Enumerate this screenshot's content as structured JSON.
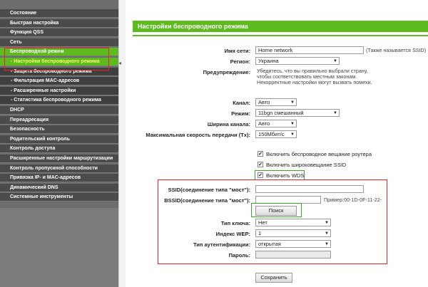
{
  "sidebar": {
    "items": [
      {
        "label": "Состояние",
        "type": "main"
      },
      {
        "label": "Быстрая настройка",
        "type": "main"
      },
      {
        "label": "Функция QSS",
        "type": "main"
      },
      {
        "label": "Сеть",
        "type": "main"
      },
      {
        "label": "Беспроводной режим",
        "type": "active"
      },
      {
        "label": "- Настройки беспроводного режима",
        "type": "sub-active"
      },
      {
        "label": "- Защита беспроводного режима",
        "type": "sub"
      },
      {
        "label": "- Фильтрация MAC-адресов",
        "type": "sub"
      },
      {
        "label": "- Расширенные настройки",
        "type": "sub"
      },
      {
        "label": "- Статистика беспроводного режима",
        "type": "sub"
      },
      {
        "label": "DHCP",
        "type": "main"
      },
      {
        "label": "Переадресация",
        "type": "main"
      },
      {
        "label": "Безопасность",
        "type": "main"
      },
      {
        "label": "Родительский контроль",
        "type": "main"
      },
      {
        "label": "Контроль доступа",
        "type": "main"
      },
      {
        "label": "Расширенные настройки маршрутизации",
        "type": "main"
      },
      {
        "label": "Контроль пропускной способности",
        "type": "main"
      },
      {
        "label": "Привязка IP- и MAC-адресов",
        "type": "main"
      },
      {
        "label": "Динамический DNS",
        "type": "main"
      },
      {
        "label": "Системные инструменты",
        "type": "main"
      }
    ]
  },
  "page": {
    "title": "Настройки беспроводного режима"
  },
  "form": {
    "ssid_label": "Имя сети:",
    "ssid_value": "Home network",
    "ssid_note": "(Также называется SSID)",
    "region_label": "Регион:",
    "region_value": "Украина",
    "warning_label": "Предупреждение:",
    "warning_lines": [
      "Убедитесь, что вы правильно выбрали страну,",
      "чтобы соответствовать местным законам.",
      "Некорректные настройки могут вызвать помехи."
    ],
    "channel_label": "Канал:",
    "channel_value": "Авто",
    "mode_label": "Режим:",
    "mode_value": "11bgn смешанный",
    "width_label": "Ширина канала:",
    "width_value": "Авто",
    "rate_label": "Максимальная скорость передачи (Tx):",
    "rate_value": "150Мбит/с",
    "check_broadcast": "Включить беспроводное вещание роутера",
    "check_ssid_broadcast": "Включить широковещание SSID",
    "check_wds": "Включить WDS",
    "wds_ssid_label": "SSID(соединение типа \"мост\"):",
    "wds_bssid_label": "BSSID(соединение типа \"мост\"):",
    "bssid_example": "Пример:00-1D-0F-11-22-",
    "search_button": "Поиск",
    "key_type_label": "Тип ключа:",
    "key_type_value": "Нет",
    "wep_index_label": "Индекс WEP:",
    "wep_index_value": "1",
    "auth_type_label": "Тип аутентификации:",
    "auth_type_value": "открытая",
    "password_label": "Пароль:",
    "save_button": "Сохранить"
  },
  "colors": {
    "accent": "#5dbb20",
    "sidebar": "#4b4b4b",
    "highlight_red": "#ee2222",
    "highlight_green": "#3da52a"
  }
}
